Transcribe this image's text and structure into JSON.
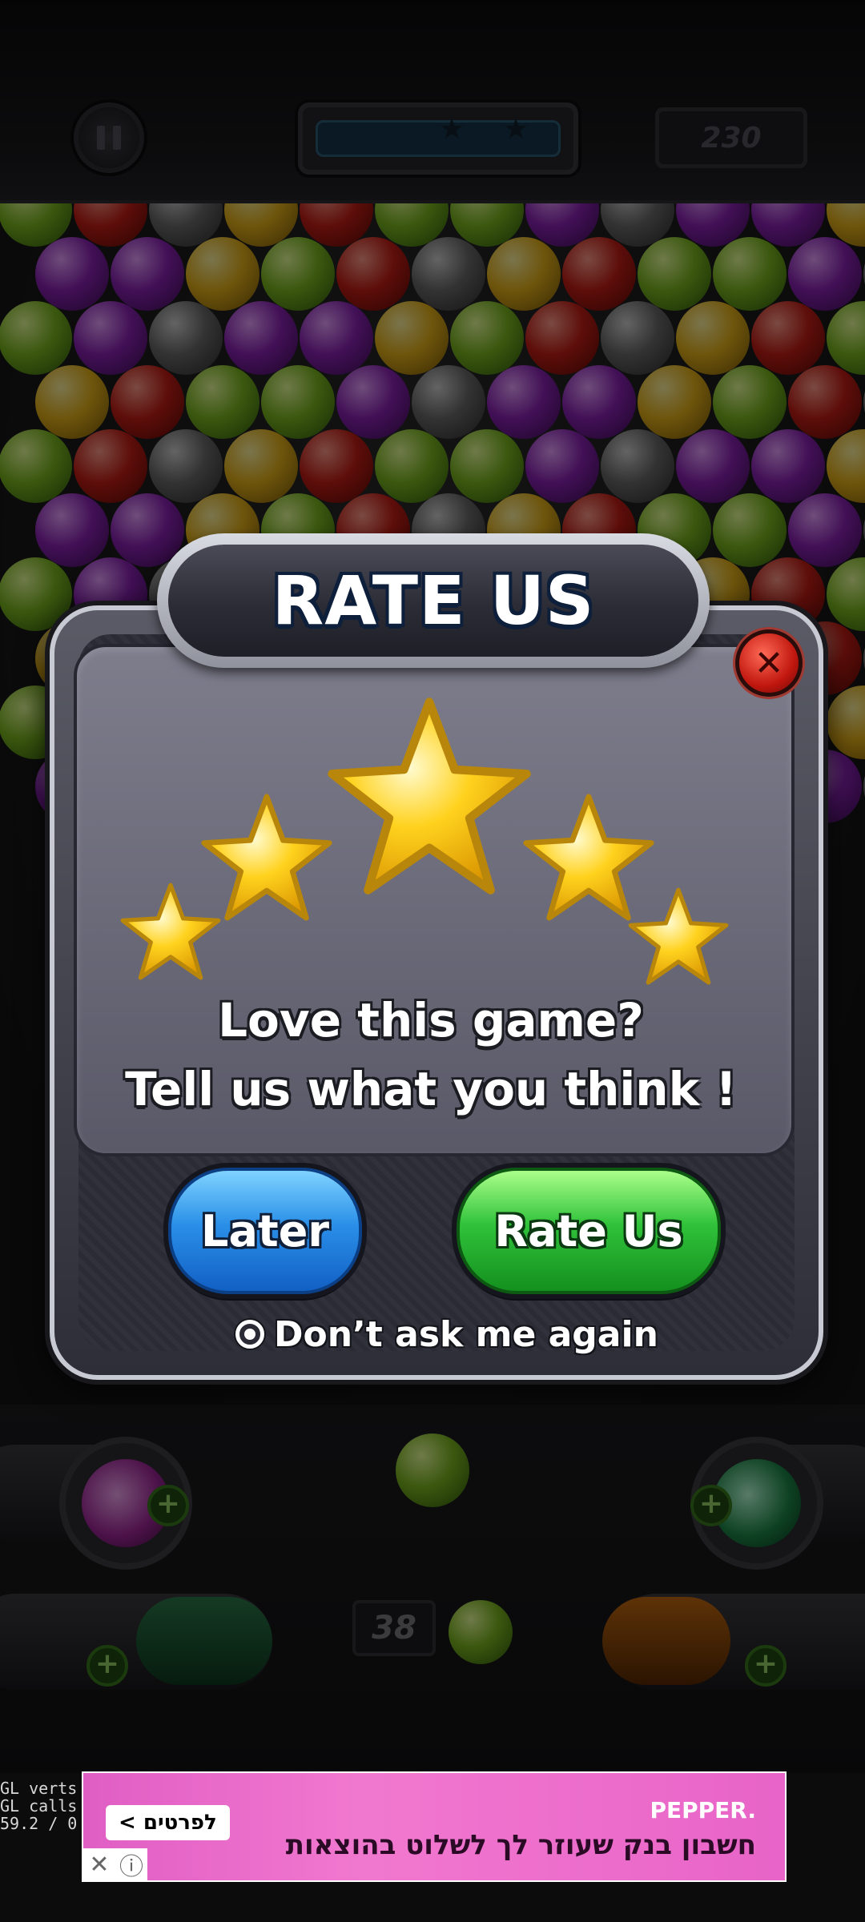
{
  "hud": {
    "score": "230",
    "moves_left": "38",
    "stars_label_1": "★",
    "stars_label_2": "★",
    "progress": 0.0
  },
  "dialog": {
    "title": "RATE US",
    "close_symbol": "✕",
    "star_rating": 5,
    "line1": "Love this game?",
    "line2": "Tell us what you think !",
    "later_button": "Later",
    "rate_button": "Rate Us",
    "dont_ask": "Don’t ask me again"
  },
  "ad": {
    "brand": "PEPPER.",
    "text": "חשבון בנק שעוזר לך לשלוט בהוצאות",
    "cta": "לפרטים >",
    "close_symbol": "✕",
    "info_symbol": "ⓘ"
  },
  "debug": {
    "gl_stats": "GL verts\nGL calls\n59.2 / 0"
  },
  "colors": {
    "rate_button": "#30c23a",
    "later_button": "#2a8fe8",
    "close_button": "#c1170f",
    "ad_background": "#e864c8"
  }
}
